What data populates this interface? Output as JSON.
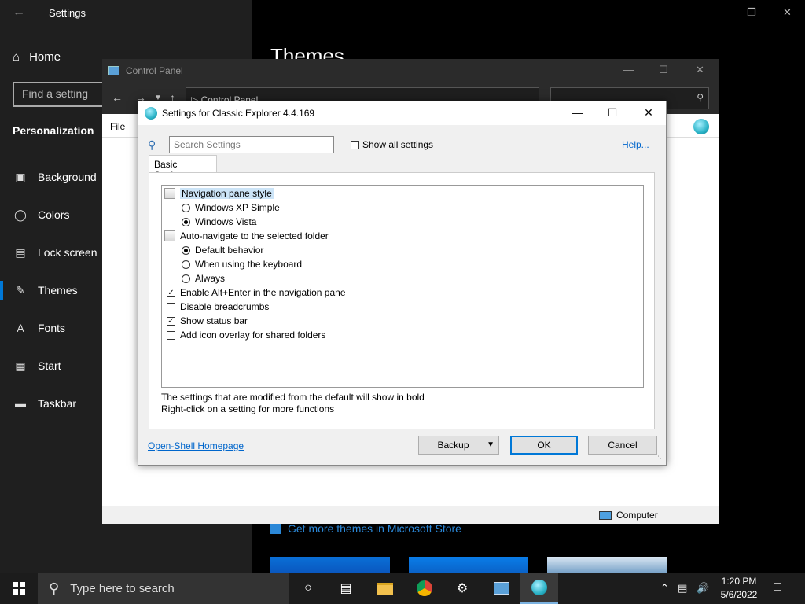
{
  "settings": {
    "title": "Settings",
    "home": "Home",
    "search_placeholder": "Find a setting",
    "section": "Personalization",
    "nav": [
      "Background",
      "Colors",
      "Lock screen",
      "Themes",
      "Fonts",
      "Start",
      "Taskbar"
    ],
    "active_nav": "Themes",
    "page_title": "Themes",
    "store_link": "Get more themes in Microsoft Store"
  },
  "control_panel": {
    "title": "Control Panel",
    "address": "Control Panel",
    "menu_file": "File",
    "status_item": "Computer"
  },
  "dialog": {
    "title": "Settings for Classic Explorer 4.4.169",
    "search_placeholder": "Search Settings",
    "show_all_label": "Show all settings",
    "show_all_checked": false,
    "help_link": "Help...",
    "tab_label": "Basic Settings",
    "tree": [
      {
        "type": "group",
        "label": "Navigation pane style",
        "selected": true
      },
      {
        "type": "radio",
        "label": "Windows XP Simple",
        "checked": false
      },
      {
        "type": "radio",
        "label": "Windows Vista",
        "checked": true
      },
      {
        "type": "group",
        "label": "Auto-navigate to the selected folder",
        "selected": false
      },
      {
        "type": "radio",
        "label": "Default behavior",
        "checked": true
      },
      {
        "type": "radio",
        "label": "When using the keyboard",
        "checked": false
      },
      {
        "type": "radio",
        "label": "Always",
        "checked": false
      },
      {
        "type": "check",
        "label": "Enable Alt+Enter in the navigation pane",
        "checked": true
      },
      {
        "type": "check",
        "label": "Disable breadcrumbs",
        "checked": false
      },
      {
        "type": "check",
        "label": "Show status bar",
        "checked": true
      },
      {
        "type": "check",
        "label": "Add icon overlay for shared folders",
        "checked": false
      }
    ],
    "note_1": "The settings that are modified from the default will show in bold",
    "note_2": "Right-click on a setting for more functions",
    "homepage_link": "Open-Shell Homepage",
    "backup_button": "Backup",
    "ok_button": "OK",
    "cancel_button": "Cancel"
  },
  "taskbar": {
    "search_placeholder": "Type here to search",
    "time": "1:20 PM",
    "date": "5/6/2022"
  },
  "colors": {
    "accent": "#0078d7",
    "link": "#0066cc",
    "selection": "#cce4f7"
  }
}
